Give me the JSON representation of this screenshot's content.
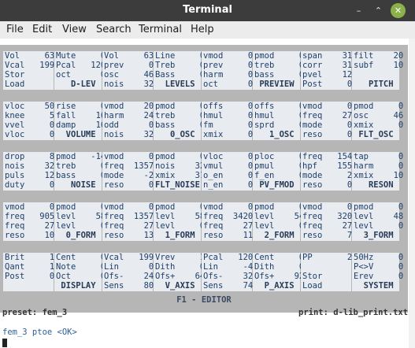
{
  "window": {
    "title": "Terminal"
  },
  "menu": [
    "File",
    "Edit",
    "View",
    "Search",
    "Terminal",
    "Help"
  ],
  "panels": [
    [
      [
        "Vol    63",
        "Vcal  199",
        "Stor",
        "Load      D-LEV"
      ],
      [
        "Mute      0",
        "Pcal  120",
        "oct       0",
        "D-LEV"
      ],
      [
        "Vol    63",
        "prev    0",
        "osc    46",
        "nois   32"
      ],
      [
        "Line    0",
        "Treb    0",
        "Bass    0",
        "LEVELS"
      ],
      [
        "vmod    0",
        "prev    0",
        "harm    0",
        "PREVIEW"
      ],
      [
        "pmod    0",
        "treb    0",
        "bass    0",
        "PREVIEW"
      ],
      [
        "span   31",
        "corr   31",
        "pvel   12",
        "Post    0"
      ],
      [
        "filt   20",
        "subf   10",
        "",
        "PITCH"
      ]
    ]
  ],
  "grid": [
    [
      {
        "lines": [
          "Vol     63",
          "Vcal   199",
          "Stor",
          ""
        ]
      },
      {
        "lines": [
          "Mute      0",
          "Pcal   120",
          "oct       0",
          "D-LEV"
        ]
      },
      {
        "lines": [
          "Vol     63",
          "prev     0",
          "osc     46",
          "nois    32"
        ]
      },
      {
        "lines": [
          "Line      0",
          "Treb      0",
          "Bass      0",
          "LEVELS"
        ]
      },
      {
        "lines": [
          "vmod      0",
          "prev      0",
          "harm      0",
          ""
        ]
      },
      {
        "lines": [
          "pmod      0",
          "treb      0",
          "bass      0",
          "PREVIEW"
        ]
      },
      {
        "lines": [
          "span     31",
          "corr     31",
          "pvel     12",
          "Post      0"
        ]
      },
      {
        "lines": [
          "filt    20",
          "subf    10",
          "",
          "PITCH"
        ]
      }
    ]
  ],
  "rows": [
    {
      "left": [
        "Vol     63",
        "Vcal   199",
        "Stor",
        "Load"
      ],
      "cells": [
        [
          "Mute      0",
          "Pcal   120",
          "oct       0",
          "   D-LEV"
        ],
        [
          "Vol     63",
          "prev     0",
          "osc     46",
          "nois    32"
        ],
        [
          "Line      0",
          "Treb      0",
          "Bass      0",
          "  LEVELS"
        ],
        [
          "vmod      0",
          "prev      0",
          "harm      0",
          "oct       0"
        ],
        [
          "pmod      0",
          "treb      0",
          "bass      0",
          " PREVIEW"
        ],
        [
          "span     31",
          "corr     31",
          "pvel     12",
          "Post      0"
        ],
        [
          "filt    20",
          "subf    10",
          "",
          "  PITCH"
        ]
      ]
    }
  ],
  "table": [
    [
      [
        "Vol     63",
        "Vcal   199",
        "Stor",
        "Load"
      ],
      [
        "Mute     0",
        "Pcal   120",
        "oct      0",
        "   D-LEV"
      ],
      [
        "Vol     63",
        "prev     0",
        "osc     46",
        "nois    32"
      ],
      [
        "Line     0",
        "Treb     0",
        "Bass     0",
        "  LEVELS"
      ],
      [
        "vmod     0",
        "prev     0",
        "harm     0",
        "oct      0"
      ],
      [
        "pmod     0",
        "treb     0",
        "bass     0",
        " PREVIEW"
      ],
      [
        "span    31",
        "corr    31",
        "pvel    12",
        "Post     0"
      ],
      [
        "filt    20",
        "subf    10",
        "",
        "   PITCH"
      ]
    ],
    [
      [
        "vloc    50",
        "knee     5",
        "vvel     0",
        "vloc     0"
      ],
      [
        "rise     0",
        "fall    16",
        "damp    16",
        "  VOLUME"
      ],
      [
        "vmod    20",
        "harm    24",
        "odd      0",
        "nois    32"
      ],
      [
        "pmod     0",
        "treb     0",
        "bass     0",
        "   0_OSC"
      ],
      [
        "offs     0",
        "hmul     0",
        "fm       0",
        "xmix     0"
      ],
      [
        "offs     0",
        "hmul     0",
        "sprd     0",
        "   1_OSC"
      ],
      [
        "vmod     0",
        "freq    27",
        "mode     0",
        "reso     0"
      ],
      [
        "pmod     0",
        "osc     46",
        "xmix     0",
        " FLT_OSC"
      ]
    ],
    [
      [
        "drop     8",
        "nois    32",
        "puls    12",
        "duty     0"
      ],
      [
        "pmod   -14",
        "treb     0",
        "bass     0",
        "   NOISE"
      ],
      [
        "vmod     0",
        "freq  1357",
        "mode    -2",
        "reso     0"
      ],
      [
        "pmod     0",
        "nois    32",
        "xmix    31",
        "FLT_NOISE"
      ],
      [
        "vloc     0",
        "vmul     0",
        "o_en     0",
        "n_en     0"
      ],
      [
        "ploc     0",
        "pmul     0",
        "f_en     0",
        " PV_FMOD"
      ],
      [
        "freq   154",
        "hpf    155",
        "mode     2",
        "reso     0"
      ],
      [
        "tap      0",
        "harm     0",
        "xmix    10",
        "   RESON"
      ]
    ],
    [
      [
        "vmod     0",
        "freq   905",
        "freq    27",
        "reso    10"
      ],
      [
        "pmod     0",
        "levl    58",
        "levl     0",
        "  0_FORM"
      ],
      [
        "vmod     0",
        "freq  1357",
        "freq    27",
        "reso    13"
      ],
      [
        "pmod     0",
        "levl    58",
        "levl     0",
        "  1_FORM"
      ],
      [
        "vmod     0",
        "freq  3420",
        "freq    27",
        "reso    11"
      ],
      [
        "pmod     0",
        "levl    54",
        "levl     0",
        "  2_FORM"
      ],
      [
        "vmod     0",
        "freq   320",
        "freq    27",
        "reso     7"
      ],
      [
        "pmod     0",
        "levl    48",
        "levl     0",
        "  3_FORM"
      ]
    ],
    [
      [
        "Brit     1",
        "Qant     1",
        "Post     0",
        ""
      ],
      [
        "Cent     0",
        "Note     0",
        "Oct      0",
        " DISPLAY"
      ],
      [
        "Vcal   199",
        "Lin      0",
        "Ofs-    24",
        "Sens    80"
      ],
      [
        "Vrev     1",
        "Dith     0",
        "Ofs+    64",
        "  V_AXIS"
      ],
      [
        "Pcal   120",
        "Lin     -4",
        "Ofs-    32",
        "Sens    74"
      ],
      [
        "Cent     0",
        "Dith     0",
        "Ofs+    92",
        "  P_AXIS"
      ],
      [
        "PP       2",
        "",
        "Stor",
        "Load"
      ],
      [
        "50Hz     0",
        "P<>V     0",
        "Erev     0",
        "  SYSTEM"
      ]
    ]
  ],
  "banner": "F1 - EDITOR",
  "status_left": "preset: fem_3",
  "status_right": "print: d-lib_print.txt",
  "prompt": "fem_3 ptoe <OK>"
}
